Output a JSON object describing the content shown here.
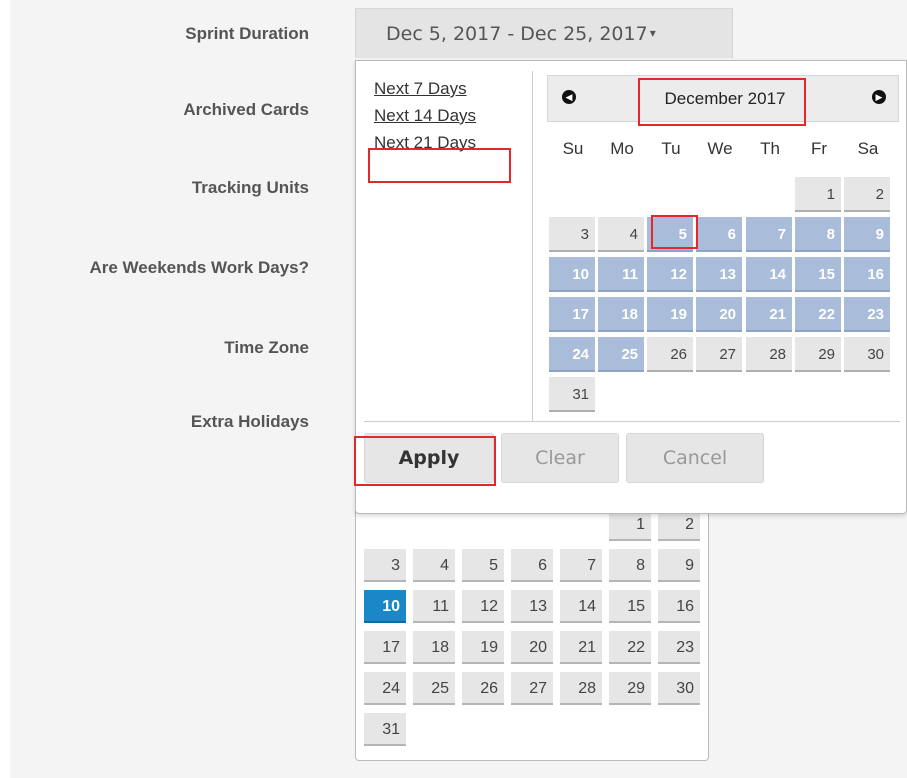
{
  "labels": {
    "sprint_duration": "Sprint Duration",
    "archived_cards": "Archived Cards",
    "tracking_units": "Tracking Units",
    "weekends": "Are Weekends Work Days?",
    "time_zone": "Time Zone",
    "extra_holidays": "Extra Holidays"
  },
  "date_range": {
    "value": "Dec 5, 2017 - Dec 25, 2017",
    "caret": "▾"
  },
  "ranges": [
    "Next 7 Days",
    "Next 14 Days",
    "Next 21 Days"
  ],
  "calendar": {
    "month_label": "December 2017",
    "prev_icon": "◀",
    "next_icon": "▶",
    "weekdays": [
      "Su",
      "Mo",
      "Tu",
      "We",
      "Th",
      "Fr",
      "Sa"
    ],
    "weeks": [
      [
        "",
        "",
        "",
        "",
        "",
        "1",
        "2"
      ],
      [
        "3",
        "4",
        "5",
        "6",
        "7",
        "8",
        "9"
      ],
      [
        "10",
        "11",
        "12",
        "13",
        "14",
        "15",
        "16"
      ],
      [
        "17",
        "18",
        "19",
        "20",
        "21",
        "22",
        "23"
      ],
      [
        "24",
        "25",
        "26",
        "27",
        "28",
        "29",
        "30"
      ],
      [
        "31",
        "",
        "",
        "",
        "",
        "",
        ""
      ]
    ],
    "selected_start": "5",
    "selected_end": "25"
  },
  "buttons": {
    "apply": "Apply",
    "clear": "Clear",
    "cancel": "Cancel"
  },
  "holiday_calendar": {
    "weeks": [
      [
        "",
        "",
        "",
        "",
        "",
        "1",
        "2"
      ],
      [
        "3",
        "4",
        "5",
        "6",
        "7",
        "8",
        "9"
      ],
      [
        "10",
        "11",
        "12",
        "13",
        "14",
        "15",
        "16"
      ],
      [
        "17",
        "18",
        "19",
        "20",
        "21",
        "22",
        "23"
      ],
      [
        "24",
        "25",
        "26",
        "27",
        "28",
        "29",
        "30"
      ],
      [
        "31",
        "",
        "",
        "",
        "",
        "",
        ""
      ]
    ],
    "today": "10"
  },
  "colors": {
    "accent": "#1a87c8",
    "range_fill": "#a9bcd9",
    "highlight": "#e5262a"
  }
}
